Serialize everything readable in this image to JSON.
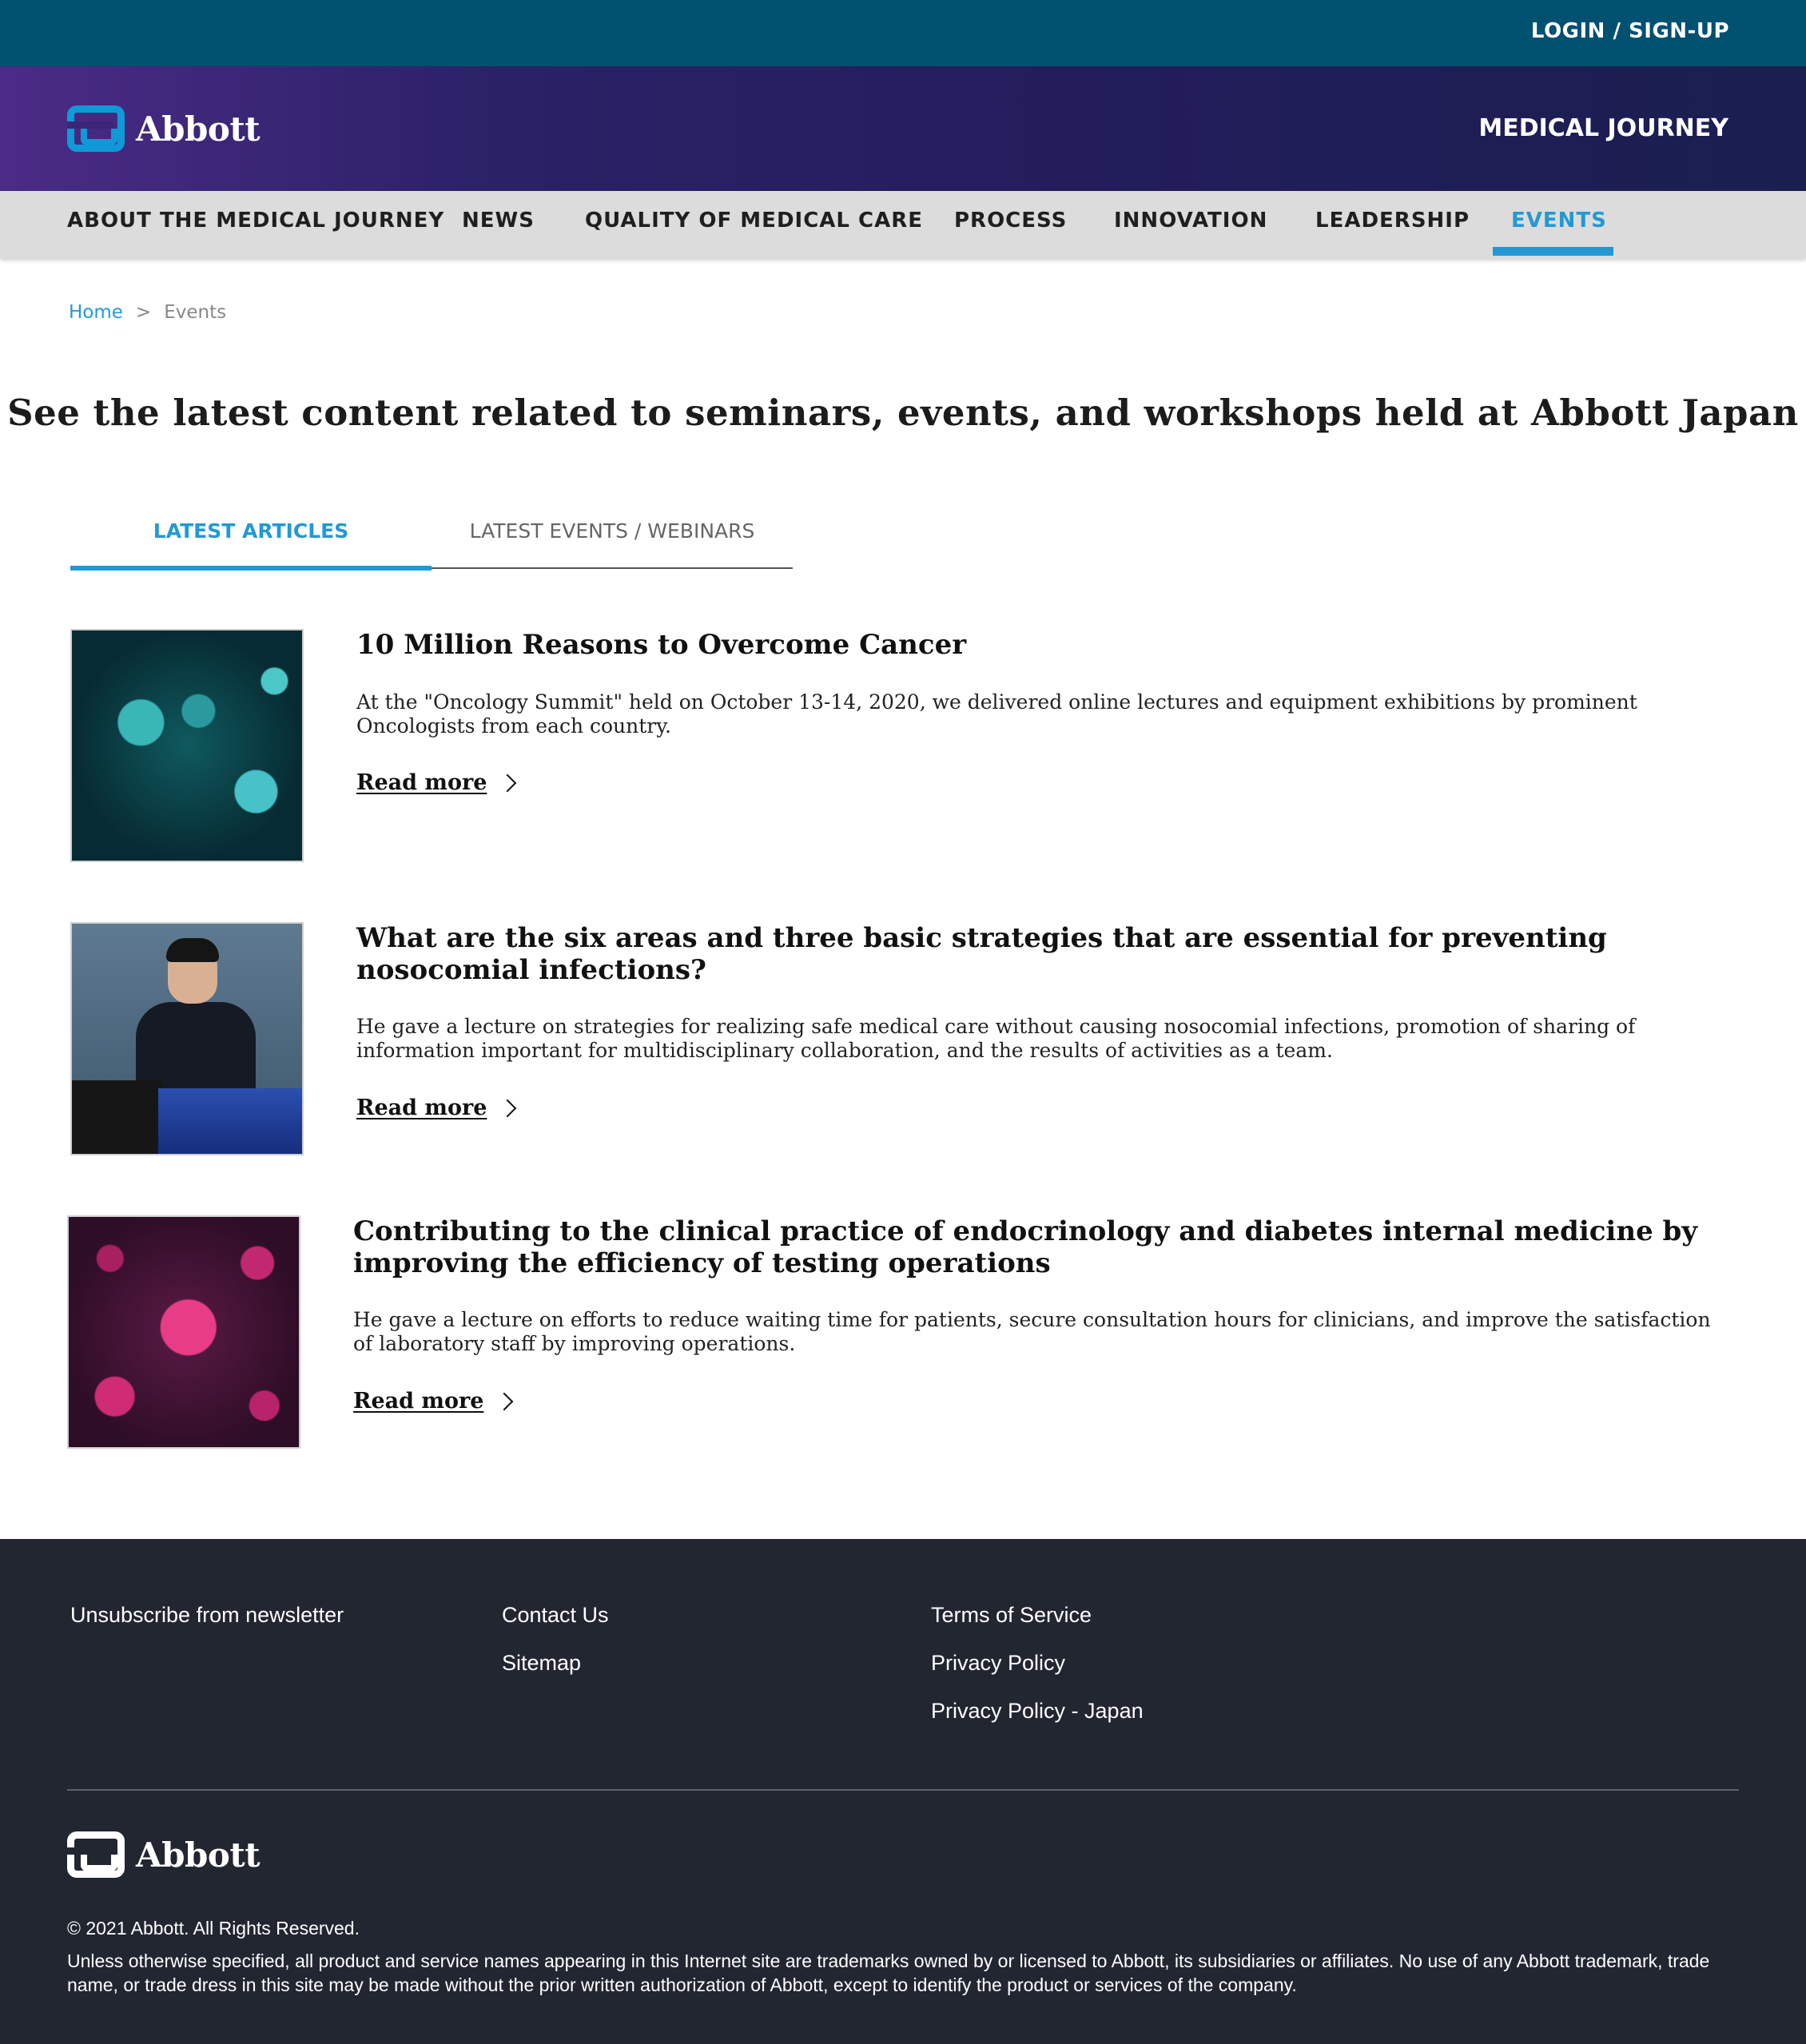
{
  "utility_bar": {
    "login_label": "LOGIN / SIGN-UP"
  },
  "brand": {
    "logo_text": "Abbott",
    "site_title": "MEDICAL JOURNEY"
  },
  "nav": {
    "items": [
      {
        "label": "ABOUT THE MEDICAL JOURNEY"
      },
      {
        "label": "NEWS"
      },
      {
        "label": "QUALITY OF MEDICAL CARE"
      },
      {
        "label": "PROCESS"
      },
      {
        "label": "INNOVATION"
      },
      {
        "label": "LEADERSHIP"
      },
      {
        "label": "EVENTS"
      }
    ],
    "active": "EVENTS",
    "active_color": "#2399d4"
  },
  "breadcrumb": {
    "home": "Home",
    "separator": ">",
    "current": "Events"
  },
  "page": {
    "heading": "See the latest content related to seminars, events, and workshops held at Abbott Japan"
  },
  "tabs": {
    "items": [
      {
        "label": "LATEST ARTICLES"
      },
      {
        "label": "LATEST EVENTS / WEBINARS"
      }
    ],
    "active": "LATEST ARTICLES"
  },
  "articles": [
    {
      "title": "10 Million Reasons to Overcome Cancer",
      "summary": "At the \"Oncology Summit\" held on October 13-14, 2020, we delivered online lectures and equipment exhibitions by prominent Oncologists from each country.",
      "read_more": "Read more",
      "image": "teal-virus-illustration"
    },
    {
      "title": "What are the six areas and three basic strategies that are essential for preventing nosocomial infections?",
      "summary": "He gave a lecture on strategies for realizing safe medical care without causing nosocomial infections, promotion of sharing of information important for multidisciplinary collaboration, and the results of activities as a team.",
      "read_more": "Read more",
      "image": "speaker-at-podium-photo"
    },
    {
      "title": "Contributing to the clinical practice of endocrinology and diabetes internal medicine by improving the efficiency of testing operations",
      "summary": "He gave a lecture on efforts to reduce waiting time for patients, secure consultation hours for clinicians, and improve the satisfaction of laboratory staff by improving operations.",
      "read_more": "Read more",
      "image": "pink-virus-illustration"
    }
  ],
  "footer": {
    "links": {
      "unsubscribe": "Unsubscribe from newsletter",
      "contact": "Contact Us",
      "sitemap": "Sitemap",
      "terms": "Terms of Service",
      "privacy": "Privacy Policy",
      "privacy_japan": "Privacy Policy - Japan"
    },
    "logo_text": "Abbott",
    "copyright": "© 2021 Abbott. All Rights Reserved.",
    "disclaimer": "Unless otherwise specified, all product and service names appearing in this Internet site are trademarks owned by or licensed to Abbott, its subsidiaries or affiliates. No use of any Abbott trademark, trade name, or trade dress in this site may be made without the prior written authorization of Abbott, except to identify the product or services of the company."
  },
  "colors": {
    "utility_bar": "#00506f",
    "brand_gradient_start": "#4b2b86",
    "brand_gradient_end": "#1a1f4f",
    "accent": "#2399d4",
    "footer_bg": "#222631"
  }
}
